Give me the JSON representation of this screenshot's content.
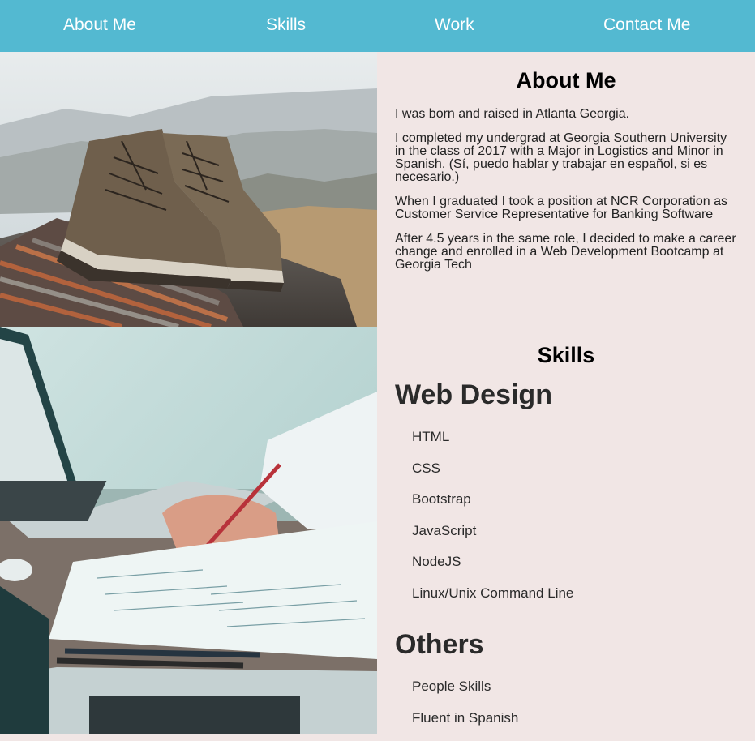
{
  "nav": {
    "items": [
      {
        "label": "About Me"
      },
      {
        "label": "Skills"
      },
      {
        "label": "Work"
      },
      {
        "label": "Contact Me"
      }
    ],
    "bg_color": "#53b9d1"
  },
  "about": {
    "title": "About Me",
    "paragraphs": [
      "I was born and raised in Atlanta Georgia.",
      "I completed my undergrad at Georgia Southern University in the class of 2017 with a Major in Logistics and Minor in Spanish. (Sí, puedo hablar y trabajar en español, si es necesario.)",
      "When I graduated I took a position at NCR Corporation as Customer Service Representative for Banking Software",
      "After 4.5 years in the same role, I decided to make a career change and enrolled in a Web Development Bootcamp at Georgia Tech"
    ]
  },
  "skills": {
    "title": "Skills",
    "groups": [
      {
        "title": "Web Design",
        "items": [
          "HTML",
          "CSS",
          "Bootstrap",
          "JavaScript",
          "NodeJS",
          "Linux/Unix Command Line"
        ]
      },
      {
        "title": "Others",
        "items": [
          "People Skills",
          "Fluent in Spanish"
        ]
      }
    ]
  },
  "images": {
    "boots": "hiking-boots-photo",
    "desk": "laptop-desk-photo"
  },
  "colors": {
    "page_bg": "#f1e6e5",
    "nav_bg": "#53b9d1"
  }
}
